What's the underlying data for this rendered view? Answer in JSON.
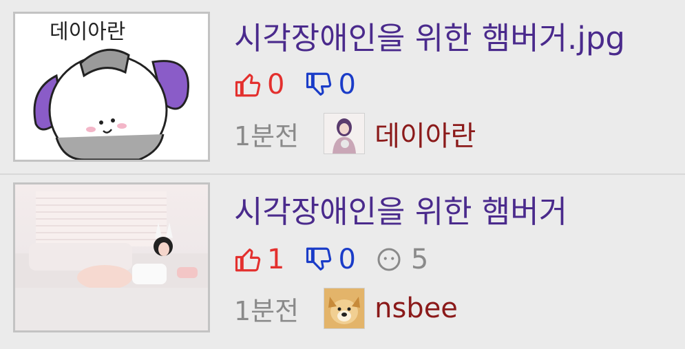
{
  "posts": [
    {
      "title": "시각장애인을 위한 햄버거.jpg",
      "upvotes": "0",
      "downvotes": "0",
      "time": "1분전",
      "author": "데이아란",
      "thumb_caption": "데이아란",
      "colors": {
        "title": "#4a2a8c",
        "up": "#e3302e",
        "down": "#1a3cc8",
        "author": "#8b1a1a"
      }
    },
    {
      "title": "시각장애인을 위한 햄버거",
      "upvotes": "1",
      "downvotes": "0",
      "comments": "5",
      "time": "1분전",
      "author": "nsbee"
    }
  ],
  "icons": {
    "upvote": "thumbs-up-icon",
    "downvote": "thumbs-down-icon",
    "comment": "comment-face-icon"
  }
}
